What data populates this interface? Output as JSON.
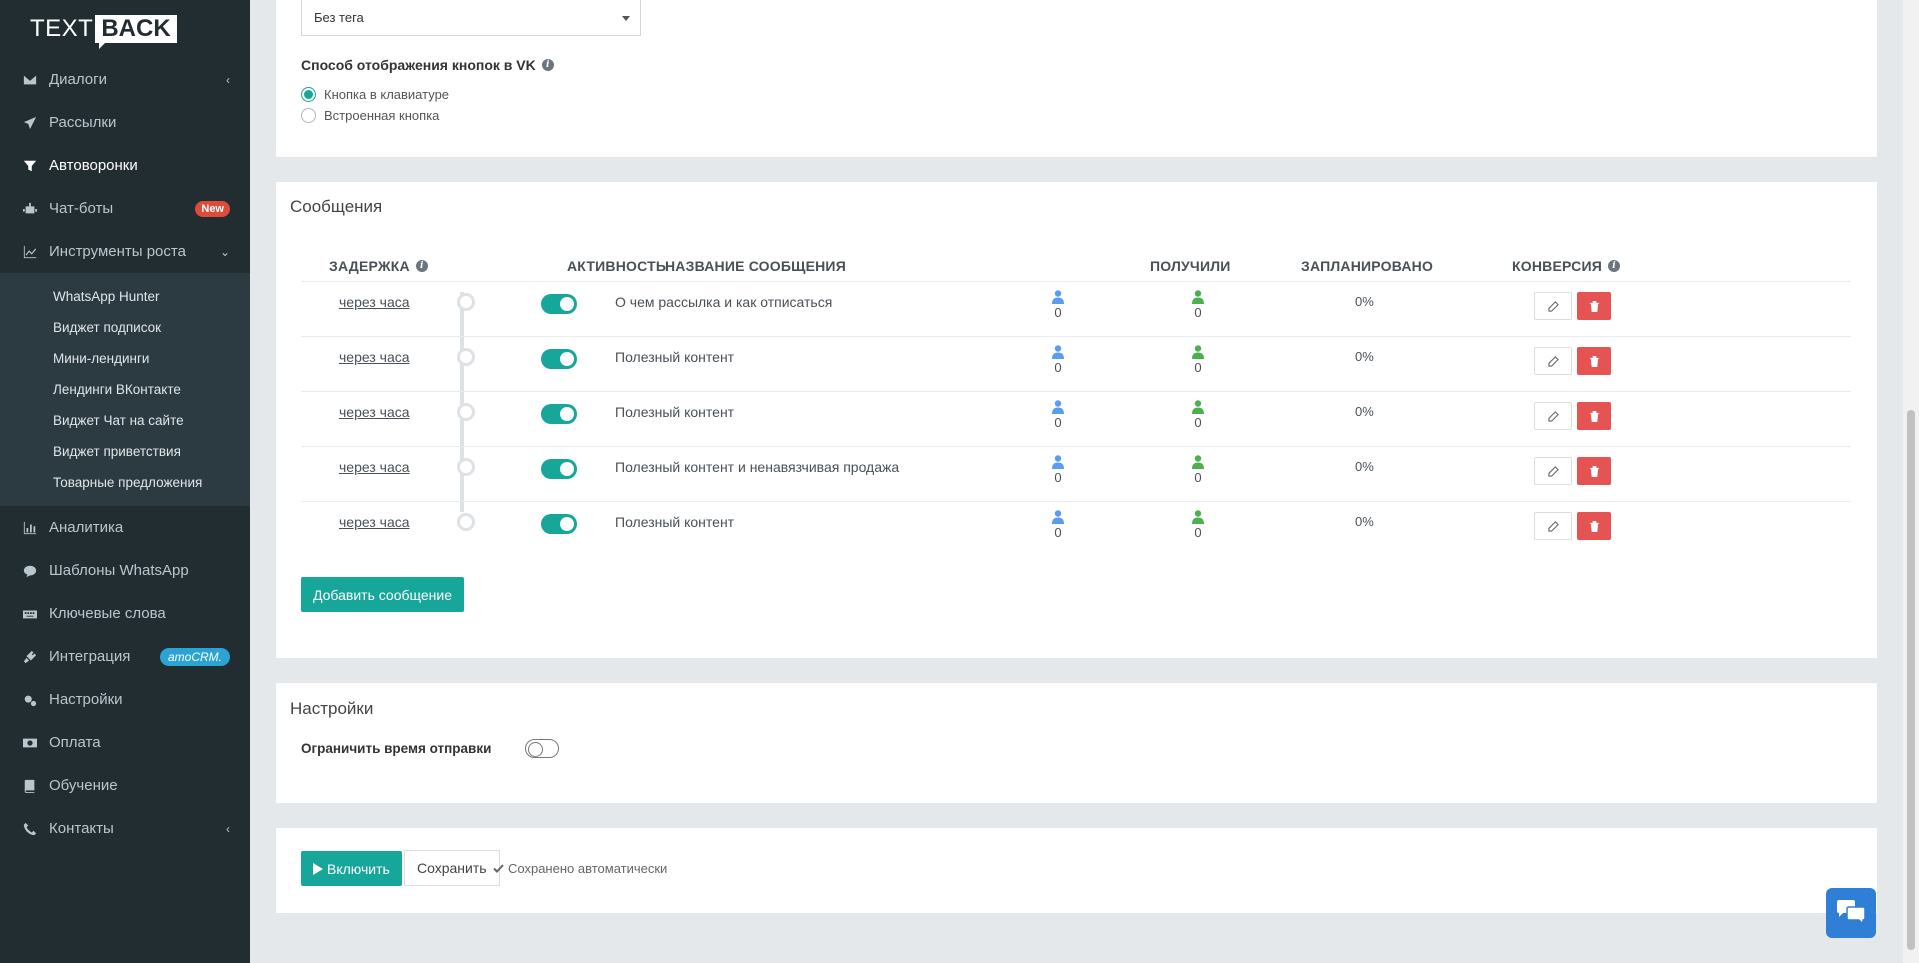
{
  "logo": {
    "text": "TEXT",
    "back": "BACK"
  },
  "sidebar": {
    "items": [
      {
        "label": "Диалоги",
        "icon": "envelope-icon",
        "chevron": "‹"
      },
      {
        "label": "Рассылки",
        "icon": "paper-plane-icon"
      },
      {
        "label": "Автоворонки",
        "icon": "filter-icon",
        "active": true
      },
      {
        "label": "Чат-боты",
        "icon": "robot-icon",
        "badge": "New"
      },
      {
        "label": "Инструменты роста",
        "icon": "line-chart-icon",
        "chevron": "⌄"
      }
    ],
    "submenu": [
      "WhatsApp Hunter",
      "Виджет подписок",
      "Мини-лендинги",
      "Лендинги ВКонтакте",
      "Виджет Чат на сайте",
      "Виджет приветствия",
      "Товарные предложения"
    ],
    "items2": [
      {
        "label": "Аналитика",
        "icon": "bar-chart-icon"
      },
      {
        "label": "Шаблоны WhatsApp",
        "icon": "comment-icon"
      },
      {
        "label": "Ключевые слова",
        "icon": "keyboard-icon"
      },
      {
        "label": "Интеграция",
        "icon": "plug-icon",
        "badge": "amoCRM."
      },
      {
        "label": "Настройки",
        "icon": "gears-icon"
      },
      {
        "label": "Оплата",
        "icon": "money-icon"
      },
      {
        "label": "Обучение",
        "icon": "book-icon"
      },
      {
        "label": "Контакты",
        "icon": "phone-icon",
        "chevron": "‹"
      }
    ]
  },
  "tag_select": {
    "value": "Без тега"
  },
  "vk_buttons": {
    "label": "Способ отображения кнопок в VK",
    "options": [
      "Кнопка в клавиатуре",
      "Встроенная кнопка"
    ],
    "selected": 0
  },
  "messages": {
    "title": "Сообщения",
    "columns": {
      "delay": "ЗАДЕРЖКА",
      "activity": "АКТИВНОСТЬ",
      "name": "НАЗВАНИЕ СООБЩЕНИЯ",
      "received": "ПОЛУЧИЛИ",
      "scheduled": "ЗАПЛАНИРОВАНО",
      "conversion": "КОНВЕРСИЯ"
    },
    "rows": [
      {
        "delay": "через часа",
        "active": true,
        "name": "О чем рассылка и как отписаться",
        "received": "0",
        "scheduled": "0",
        "conversion": "0%"
      },
      {
        "delay": "через часа",
        "active": true,
        "name": "Полезный контент",
        "received": "0",
        "scheduled": "0",
        "conversion": "0%"
      },
      {
        "delay": "через часа",
        "active": true,
        "name": "Полезный контент",
        "received": "0",
        "scheduled": "0",
        "conversion": "0%"
      },
      {
        "delay": "через часа",
        "active": true,
        "name": "Полезный контент и ненавязчивая продажа",
        "received": "0",
        "scheduled": "0",
        "conversion": "0%"
      },
      {
        "delay": "через часа",
        "active": true,
        "name": "Полезный контент",
        "received": "0",
        "scheduled": "0",
        "conversion": "0%"
      }
    ],
    "add_button": "Добавить сообщение"
  },
  "settings": {
    "title": "Настройки",
    "limit_time_label": "Ограничить время отправки"
  },
  "footer": {
    "enable_button": "Включить",
    "save_button": "Сохранить",
    "auto_saved": "Сохранено автоматически"
  },
  "colors": {
    "accent": "#17a69a",
    "danger": "#e55353",
    "sidebar": "#222d32",
    "received_icon": "#5b9bf0",
    "scheduled_icon": "#4caf50"
  }
}
